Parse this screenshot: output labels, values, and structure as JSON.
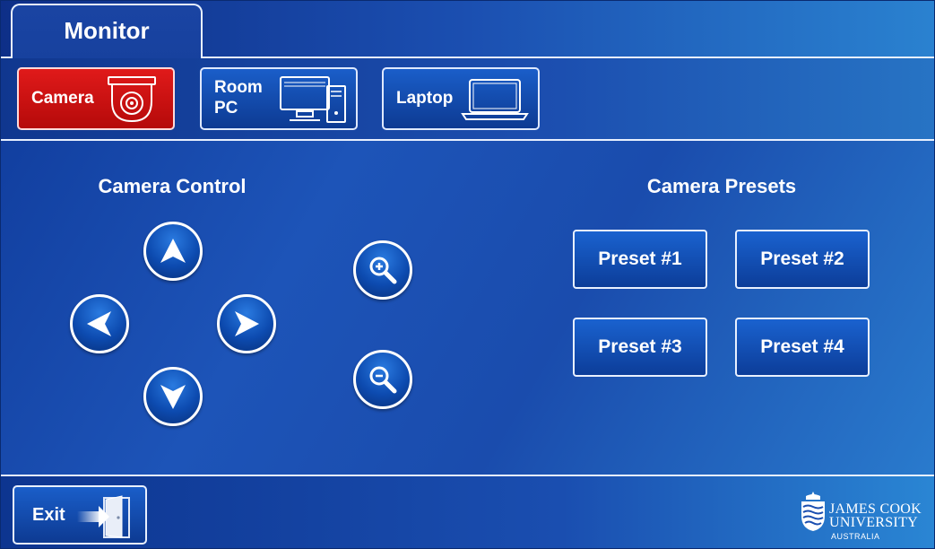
{
  "tabs": {
    "active_label": "Monitor"
  },
  "sources": [
    {
      "label": "Camera",
      "icon": "security-camera-icon",
      "active": true
    },
    {
      "label": "Room\nPC",
      "label_line1": "Room",
      "label_line2": "PC",
      "icon": "desktop-pc-icon",
      "active": false
    },
    {
      "label": "Laptop",
      "icon": "laptop-icon",
      "active": false
    }
  ],
  "camera_control": {
    "title": "Camera Control",
    "buttons": {
      "up": "arrow-up-icon",
      "down": "arrow-down-icon",
      "left": "arrow-left-icon",
      "right": "arrow-right-icon",
      "zoom_in": "zoom-in-icon",
      "zoom_out": "zoom-out-icon"
    }
  },
  "camera_presets": {
    "title": "Camera Presets",
    "presets": [
      "Preset #1",
      "Preset #2",
      "Preset #3",
      "Preset #4"
    ]
  },
  "footer": {
    "exit_label": "Exit",
    "exit_icon": "door-exit-icon",
    "logo_line1": "JAMES COOK",
    "logo_line2": "UNIVERSITY",
    "logo_line3": "AUSTRALIA"
  },
  "colors": {
    "active_source": "#d81414",
    "button_blue": "#0d4bb0",
    "background": "#1a4aa8"
  }
}
